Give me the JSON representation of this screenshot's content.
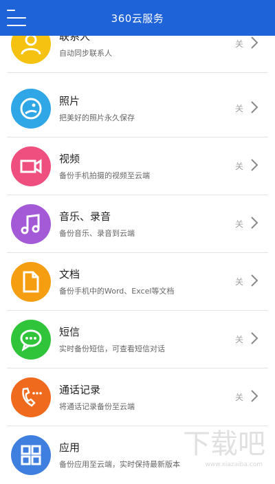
{
  "header": {
    "title": "360云服务",
    "bg_color": "#1f63d8",
    "menu_icon": "menu-icon"
  },
  "items": [
    {
      "name": "联系人",
      "desc": "自动同步联系人",
      "state": "关",
      "color": "#f5c211",
      "icon": "contact-icon"
    },
    {
      "name": "照片",
      "desc": "把美好的照片永久保存",
      "state": "关",
      "color": "#2fa6e6",
      "icon": "photo-icon"
    },
    {
      "name": "视频",
      "desc": "备份手机拍摄的视频至云端",
      "state": "关",
      "color": "#ee4f7f",
      "icon": "video-icon"
    },
    {
      "name": "音乐、录音",
      "desc": "备份音乐、录音到云端",
      "state": "关",
      "color": "#a45ad6",
      "icon": "music-icon"
    },
    {
      "name": "文档",
      "desc": "备份手机中的Word、Excel等文档",
      "state": "关",
      "color": "#f59e12",
      "icon": "document-icon"
    },
    {
      "name": "短信",
      "desc": "实时备份短信，可查看短信对话",
      "state": "关",
      "color": "#2fc43a",
      "icon": "sms-icon"
    },
    {
      "name": "通话记录",
      "desc": "将通话记录备份至云端",
      "state": "关",
      "color": "#f06a1e",
      "icon": "call-log-icon"
    },
    {
      "name": "应用",
      "desc": "备份应用至云端，实时保持最新版本",
      "state": "",
      "color": "#3f7fe0",
      "icon": "apps-icon"
    }
  ],
  "watermark": {
    "text": "www.xiazaiba.com",
    "logo_text": "下载吧"
  }
}
